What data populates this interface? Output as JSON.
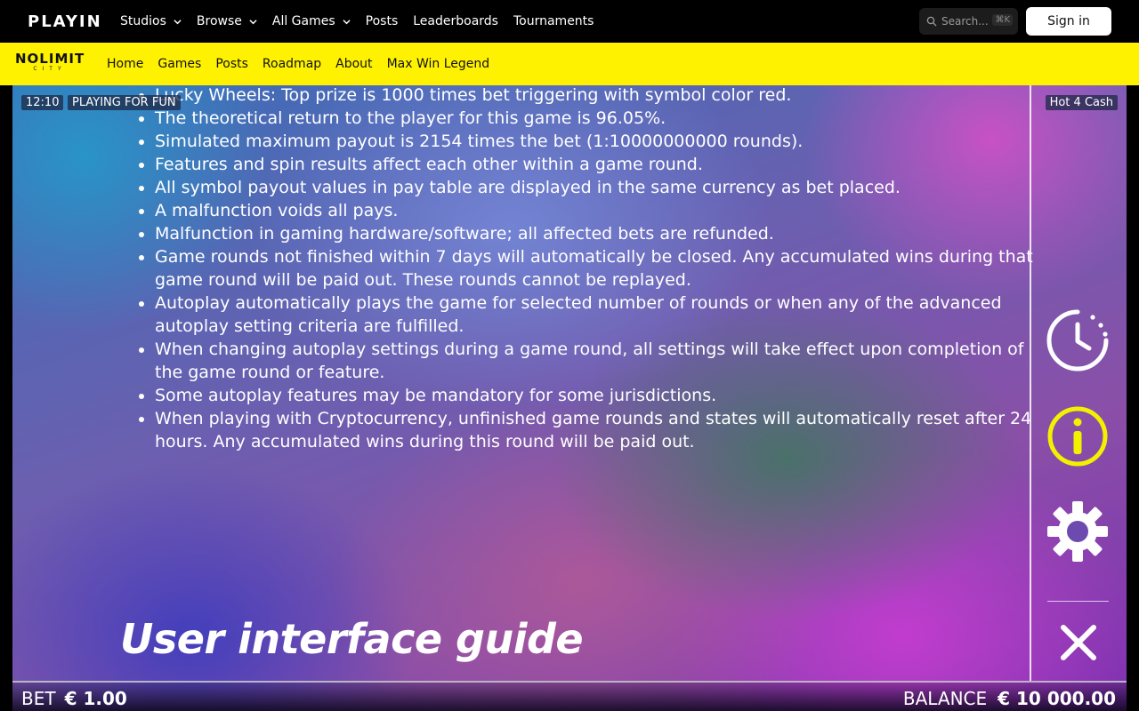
{
  "header": {
    "logo": "PLAYIN",
    "nav": [
      {
        "label": "Studios",
        "dropdown": true
      },
      {
        "label": "Browse",
        "dropdown": true
      },
      {
        "label": "All Games",
        "dropdown": true
      },
      {
        "label": "Posts",
        "dropdown": false
      },
      {
        "label": "Leaderboards",
        "dropdown": false
      },
      {
        "label": "Tournaments",
        "dropdown": false
      }
    ],
    "search_placeholder": "Search...",
    "search_shortcut": "⌘K",
    "signin_label": "Sign in"
  },
  "subnav": {
    "studio_logo_main": "NOLIMIT",
    "studio_logo_sub": "CITY",
    "items": [
      "Home",
      "Games",
      "Posts",
      "Roadmap",
      "About",
      "Max Win Legend"
    ],
    "bg_color": "#fff200"
  },
  "game": {
    "clock": "12:10",
    "mode_badge": "PLAYING FOR FUN",
    "game_name": "Hot 4 Cash",
    "rules": [
      "Lucky Wheels: Top prize is 1000 times bet triggering with symbol color red.",
      "The theoretical return to the player for this game is 96.05%.",
      "Simulated maximum payout is 2154 times the bet (1:10000000000 rounds).",
      "Features and spin results affect each other within a game round.",
      "All symbol payout values in pay table are displayed in the same currency as bet placed.",
      "A malfunction voids all pays.",
      "Malfunction in gaming hardware/software; all affected bets are refunded.",
      "Game rounds not finished within 7 days will automatically be closed. Any accumulated wins during that game round will be paid out. These rounds cannot be replayed.",
      "Autoplay automatically plays the game for selected number of rounds or when any of the advanced autoplay setting criteria are fulfilled.",
      "When changing autoplay settings during a game round, all settings will take effect upon completion of the game round or feature.",
      "Some autoplay features may be mandatory for some jurisdictions.",
      "When playing with Cryptocurrency, unfinished game rounds and states will automatically reset after 24 hours. Any accumulated wins during this round will be paid out."
    ],
    "guide_title": "User interface guide",
    "icons": [
      "history-clock-icon",
      "info-icon",
      "settings-gear-icon",
      "close-icon"
    ],
    "accent_color": "#f2f200",
    "bet_label": "BET",
    "bet_value": "€ 1.00",
    "balance_label": "BALANCE",
    "balance_value": "€ 10 000.00"
  }
}
